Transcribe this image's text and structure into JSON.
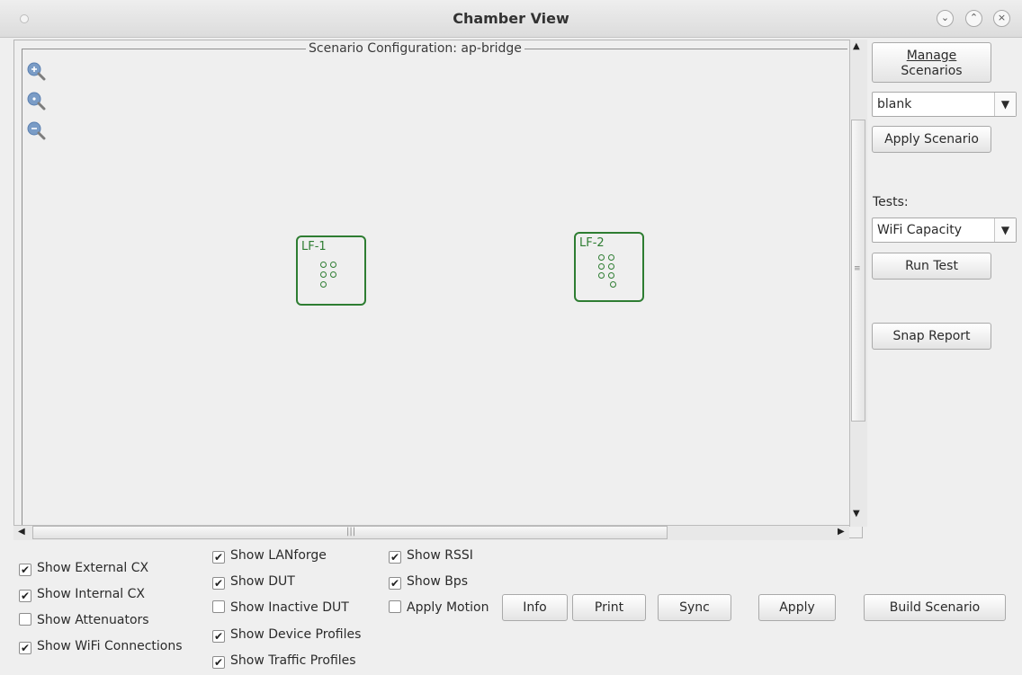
{
  "window": {
    "title": "Chamber View"
  },
  "scenario": {
    "title": "Scenario Configuration:  ap-bridge"
  },
  "devices": [
    {
      "label": "LF-1"
    },
    {
      "label": "LF-2"
    }
  ],
  "sidebar": {
    "manage_line1": "Manage",
    "manage_line2": "Scenarios",
    "scenario_select": "blank",
    "apply_scenario": "Apply Scenario",
    "tests_label": "Tests:",
    "tests_select": "WiFi Capacity",
    "run_test": "Run Test",
    "snap_report": "Snap Report"
  },
  "options": {
    "col1": [
      {
        "label": "Show External CX",
        "checked": true
      },
      {
        "label": "Show Internal CX",
        "checked": true
      },
      {
        "label": "Show Attenuators",
        "checked": false
      },
      {
        "label": "Show WiFi Connections",
        "checked": true
      }
    ],
    "col2": [
      {
        "label": "Show LANforge",
        "checked": true
      },
      {
        "label": "Show DUT",
        "checked": true
      },
      {
        "label": "Show Inactive DUT",
        "checked": false
      },
      {
        "label": "Show Device Profiles",
        "checked": true
      },
      {
        "label": "Show Traffic Profiles",
        "checked": true
      }
    ],
    "col3": [
      {
        "label": "Show RSSI",
        "checked": true
      },
      {
        "label": "Show Bps",
        "checked": true
      },
      {
        "label": "Apply Motion",
        "checked": false
      }
    ]
  },
  "bottom_buttons": {
    "info": "Info",
    "print": "Print",
    "sync": "Sync",
    "apply": "Apply",
    "build": "Build Scenario"
  },
  "icons": {
    "zoom_in": "zoom-in-icon",
    "zoom_reset": "zoom-reset-icon",
    "zoom_out": "zoom-out-icon"
  },
  "colors": {
    "device_border": "#2e7d32",
    "zoom_icon": "#7a9cc6"
  }
}
